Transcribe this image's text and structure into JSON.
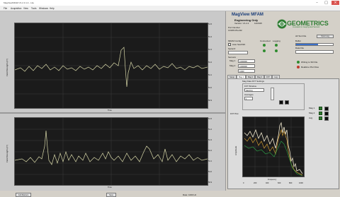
{
  "window": {
    "title": "MagViewMFAM V1.2.3.1.4 - Lite"
  },
  "menu": [
    "File",
    "Acquisition",
    "View",
    "Tools",
    "Windows",
    "Help"
  ],
  "top_chart": {
    "ylabel": "Field Strength (nT)",
    "xlabel": "Time",
    "left_ticks": [
      "54100",
      "54080",
      "54060",
      "54040",
      "54020",
      "54000"
    ],
    "right_ticks": [
      "51.5",
      "51.4",
      "51.3",
      "51.2",
      "51.1",
      "51.0",
      "50.9"
    ]
  },
  "bottom_chart": {
    "ylabel": "Field Strength (nT)",
    "xlabel": "Time",
    "left_ticks": [
      "54100",
      "54080",
      "54060",
      "54040",
      "54020",
      "54000"
    ],
    "right_ticks": [
      "51.5",
      "51.4",
      "51.3",
      "51.2",
      "51.1",
      "51.0",
      "50.9"
    ]
  },
  "status": {
    "left": "Add Markers",
    "mid": "Save",
    "right": "Rate: 1000 Hz"
  },
  "app": {
    "name": "MagView MFAM",
    "subtitle": "Engineering Only",
    "version": "Version: V1.2.2",
    "date": "12/2015",
    "port_label": "Port Number",
    "port_value": "COM6 RS-232"
  },
  "logo": {
    "name": "GEOMETRICS",
    "tagline": "Innovation in Geophysical Sensors"
  },
  "controls": {
    "mfam_config": "MFAM Config",
    "serial": "Serial #",
    "checkbox_label": "Auto Set/ASK",
    "sensors_label": "Sensors",
    "connected_label": "Connected",
    "logging_label": "Logging",
    "mag1_label": "Mag 1",
    "mag2_label": "Mag 2",
    "all_text_file": "All Text File",
    "open_log": "Open Log",
    "buffer_label": "Buffer",
    "file_label": "Data File",
    "mag1_value": "0.000000",
    "mag2_value": "0.000000",
    "rate_value": "0.000",
    "writing_text": "Writing to SD File",
    "realtime_text": "Realtime Plot Files"
  },
  "tabs": [
    "Setup",
    "Mag 1",
    "Mag 2",
    "Mag 3",
    "FFT",
    "Log"
  ],
  "fft": {
    "settings_title": "Mag Data FFT Settings",
    "window_label": "FFT Window",
    "window_value": "Hanning",
    "avg_label": "Averages",
    "avg_value": "1",
    "title": "FFT Plot",
    "ylabel": "Amplitude",
    "xlabel": "Frequency",
    "legend": [
      "Mag 1",
      "Mag 2",
      "Avg"
    ],
    "xticks": [
      "0",
      "200",
      "400",
      "600",
      "800",
      "1000"
    ],
    "yticks": [
      "1",
      "0.1",
      "0.01",
      "1E-3",
      "1E-4",
      "1E-5"
    ]
  }
}
